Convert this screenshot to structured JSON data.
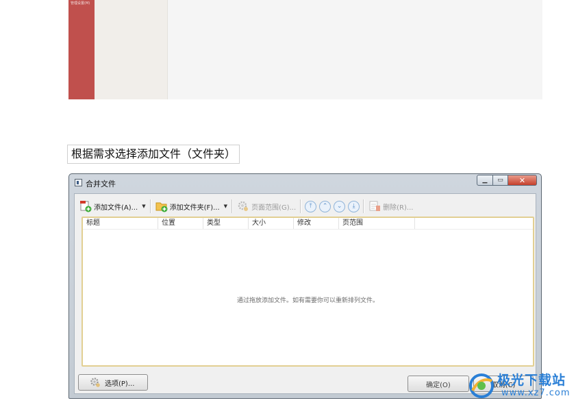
{
  "top_screenshot": {
    "sidebar_text": "管理设置(M)"
  },
  "caption": "根据需求选择添加文件（文件夹）",
  "dialog": {
    "title": "合并文件",
    "toolbar": {
      "add_file": "添加文件(A)...",
      "add_folder": "添加文件夹(F)...",
      "page_range": "页面范围(G)...",
      "delete": "删除(R)..."
    },
    "columns": [
      "标题",
      "位置",
      "类型",
      "大小",
      "修改",
      "页范围"
    ],
    "empty_hint": "通过拖放添加文件。如有需要你可以重新排列文件。",
    "options_button": "选项(P)...",
    "ok_button": "确定(O)",
    "cancel_button": "取消(C)"
  },
  "watermark": {
    "name": "极光下载站",
    "url": "www.xz7.com"
  },
  "colors": {
    "accent_red": "#c0504d",
    "list_border": "#e2cf92",
    "watermark_blue": "#2a7fd6"
  }
}
